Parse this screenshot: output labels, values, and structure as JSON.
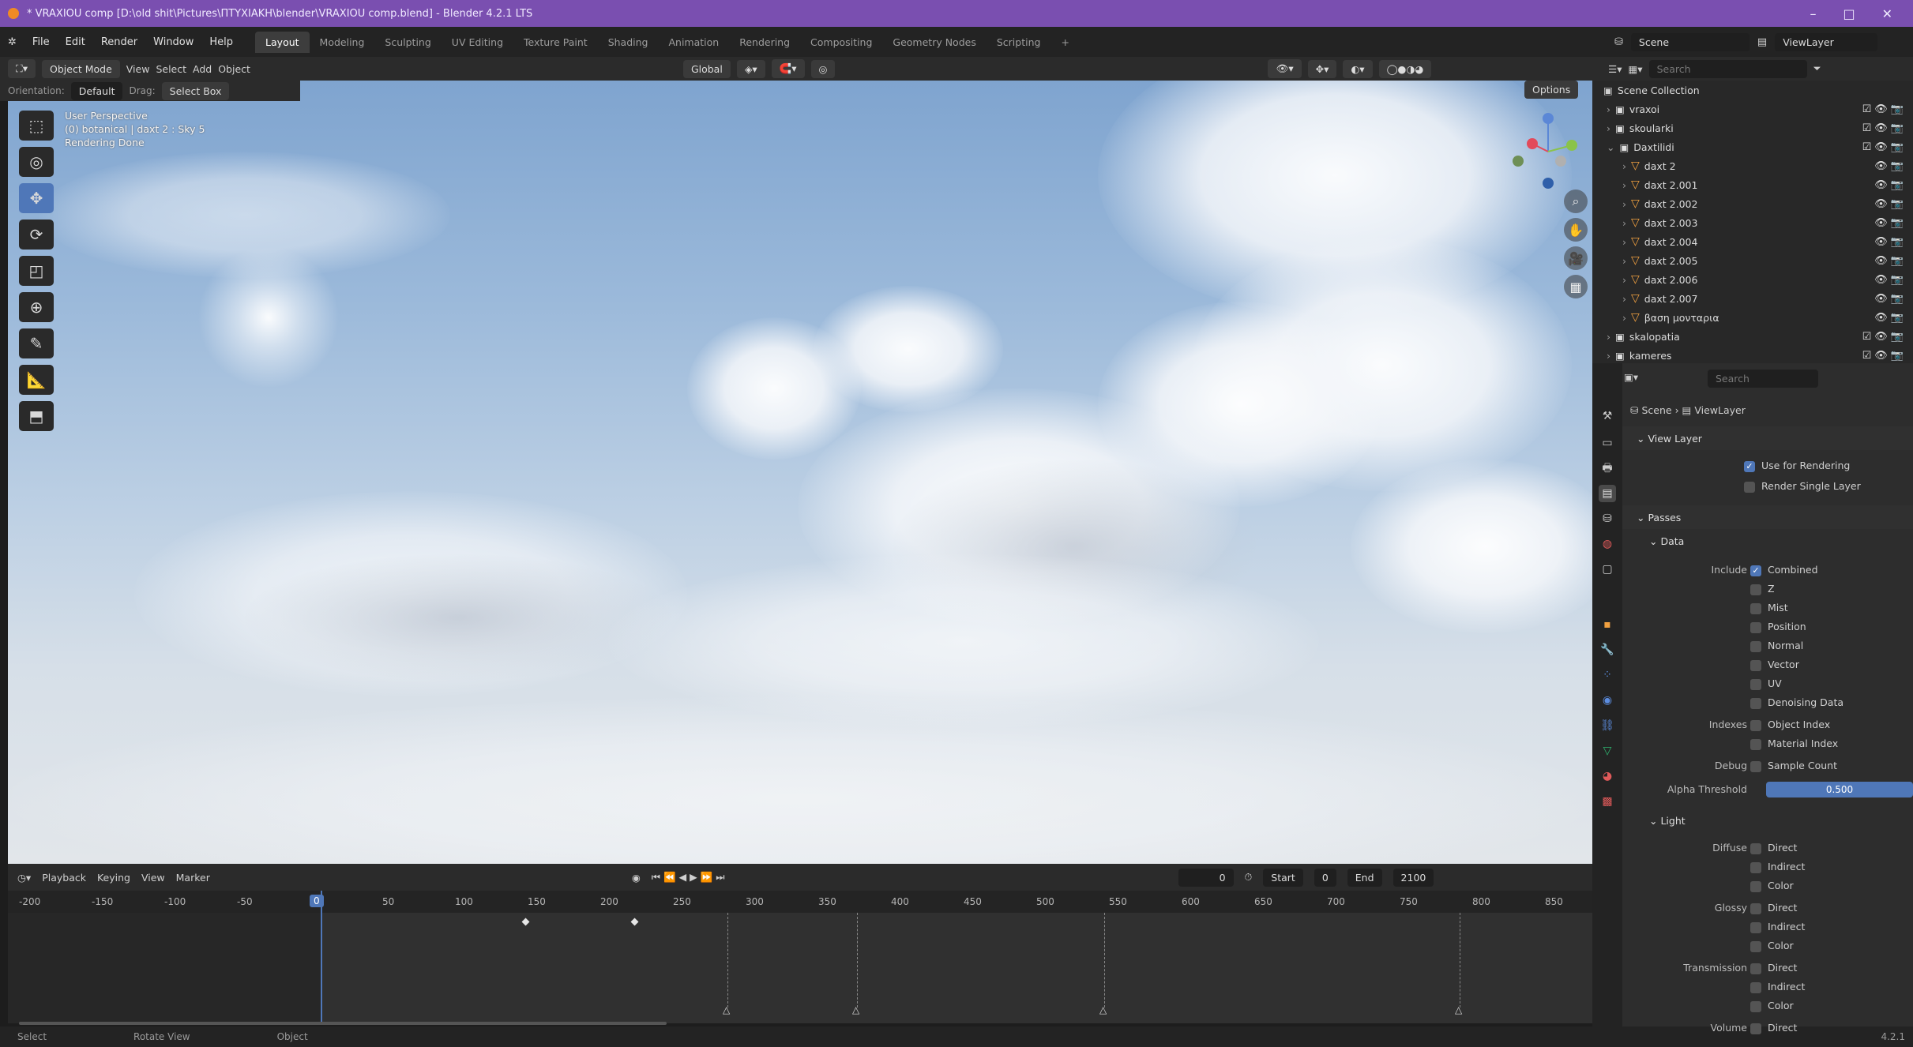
{
  "title_bar": {
    "text": "* VRAXIOU comp [D:\\old shit\\Pictures\\ΠΤΥΧΙΑΚΗ\\blender\\VRAXIOU comp.blend] - Blender 4.2.1 LTS",
    "minimize": "–",
    "maximize": "□",
    "close": "✕"
  },
  "menu": [
    "File",
    "Edit",
    "Render",
    "Window",
    "Help"
  ],
  "workspaces": [
    "Layout",
    "Modeling",
    "Sculpting",
    "UV Editing",
    "Texture Paint",
    "Shading",
    "Animation",
    "Rendering",
    "Compositing",
    "Geometry Nodes",
    "Scripting",
    "+"
  ],
  "viewport_header": {
    "mode": "Object Mode",
    "view": "View",
    "select": "Select",
    "add": "Add",
    "object": "Object",
    "transform": "Global",
    "orientation_label": "Orientation:",
    "orientation": "Default",
    "drag_label": "Drag:",
    "drag": "Select Box",
    "options": "Options"
  },
  "viewport_overlay": {
    "line1": "User Perspective",
    "line2": "(0) botanical | daxt 2 : Sky 5",
    "line3": "Rendering Done"
  },
  "timeline": {
    "playback": "Playback",
    "keying": "Keying",
    "view": "View",
    "marker": "Marker",
    "current_frame": "0",
    "start_label": "Start",
    "start": "0",
    "end_label": "End",
    "end": "2100",
    "ticks": [
      "-200",
      "-150",
      "-100",
      "-50",
      "0",
      "50",
      "100",
      "150",
      "200",
      "250",
      "300",
      "350",
      "400",
      "450",
      "500",
      "550",
      "600",
      "650",
      "700",
      "750",
      "800",
      "850"
    ]
  },
  "status_bar": {
    "select": "Select",
    "rotate": "Rotate View",
    "object": "Object",
    "version": "4.2.1"
  },
  "scene_header": {
    "scene": "Scene",
    "view_layer": "ViewLayer"
  },
  "outliner": {
    "search_placeholder": "Search",
    "root": "Scene Collection",
    "rows": [
      {
        "name": "vraxoi",
        "indent": 1
      },
      {
        "name": "skoularki",
        "indent": 1
      },
      {
        "name": "Daxtilidi",
        "indent": 1
      },
      {
        "name": "daxt 2",
        "indent": 2
      },
      {
        "name": "daxt 2.001",
        "indent": 2
      },
      {
        "name": "daxt 2.002",
        "indent": 2
      },
      {
        "name": "daxt 2.003",
        "indent": 2
      },
      {
        "name": "daxt 2.004",
        "indent": 2
      },
      {
        "name": "daxt 2.005",
        "indent": 2
      },
      {
        "name": "daxt 2.006",
        "indent": 2
      },
      {
        "name": "daxt 2.007",
        "indent": 2
      },
      {
        "name": "βαση μονταρια",
        "indent": 2
      },
      {
        "name": "skalopatia",
        "indent": 1
      },
      {
        "name": "kameres",
        "indent": 1
      }
    ]
  },
  "properties": {
    "search_placeholder": "Search",
    "breadcrumb_scene": "Scene",
    "breadcrumb_layer": "ViewLayer",
    "view_layer_section": "View Layer",
    "use_for_rendering": "Use for Rendering",
    "render_single_layer": "Render Single Layer",
    "passes_section": "Passes",
    "data_section": "Data",
    "include_label": "Include",
    "data_passes": [
      "Combined",
      "Z",
      "Mist",
      "Position",
      "Normal",
      "Vector",
      "UV",
      "Denoising Data"
    ],
    "indexes_label": "Indexes",
    "index_passes": [
      "Object Index",
      "Material Index"
    ],
    "debug_label": "Debug",
    "debug_pass": "Sample Count",
    "alpha_label": "Alpha Threshold",
    "alpha_value": "0.500",
    "light_section": "Light",
    "diffuse_label": "Diffuse",
    "glossy_label": "Glossy",
    "transmission_label": "Transmission",
    "volume_label": "Volume",
    "light_opts": [
      "Direct",
      "Indirect",
      "Color"
    ],
    "volume_opt": "Direct"
  }
}
